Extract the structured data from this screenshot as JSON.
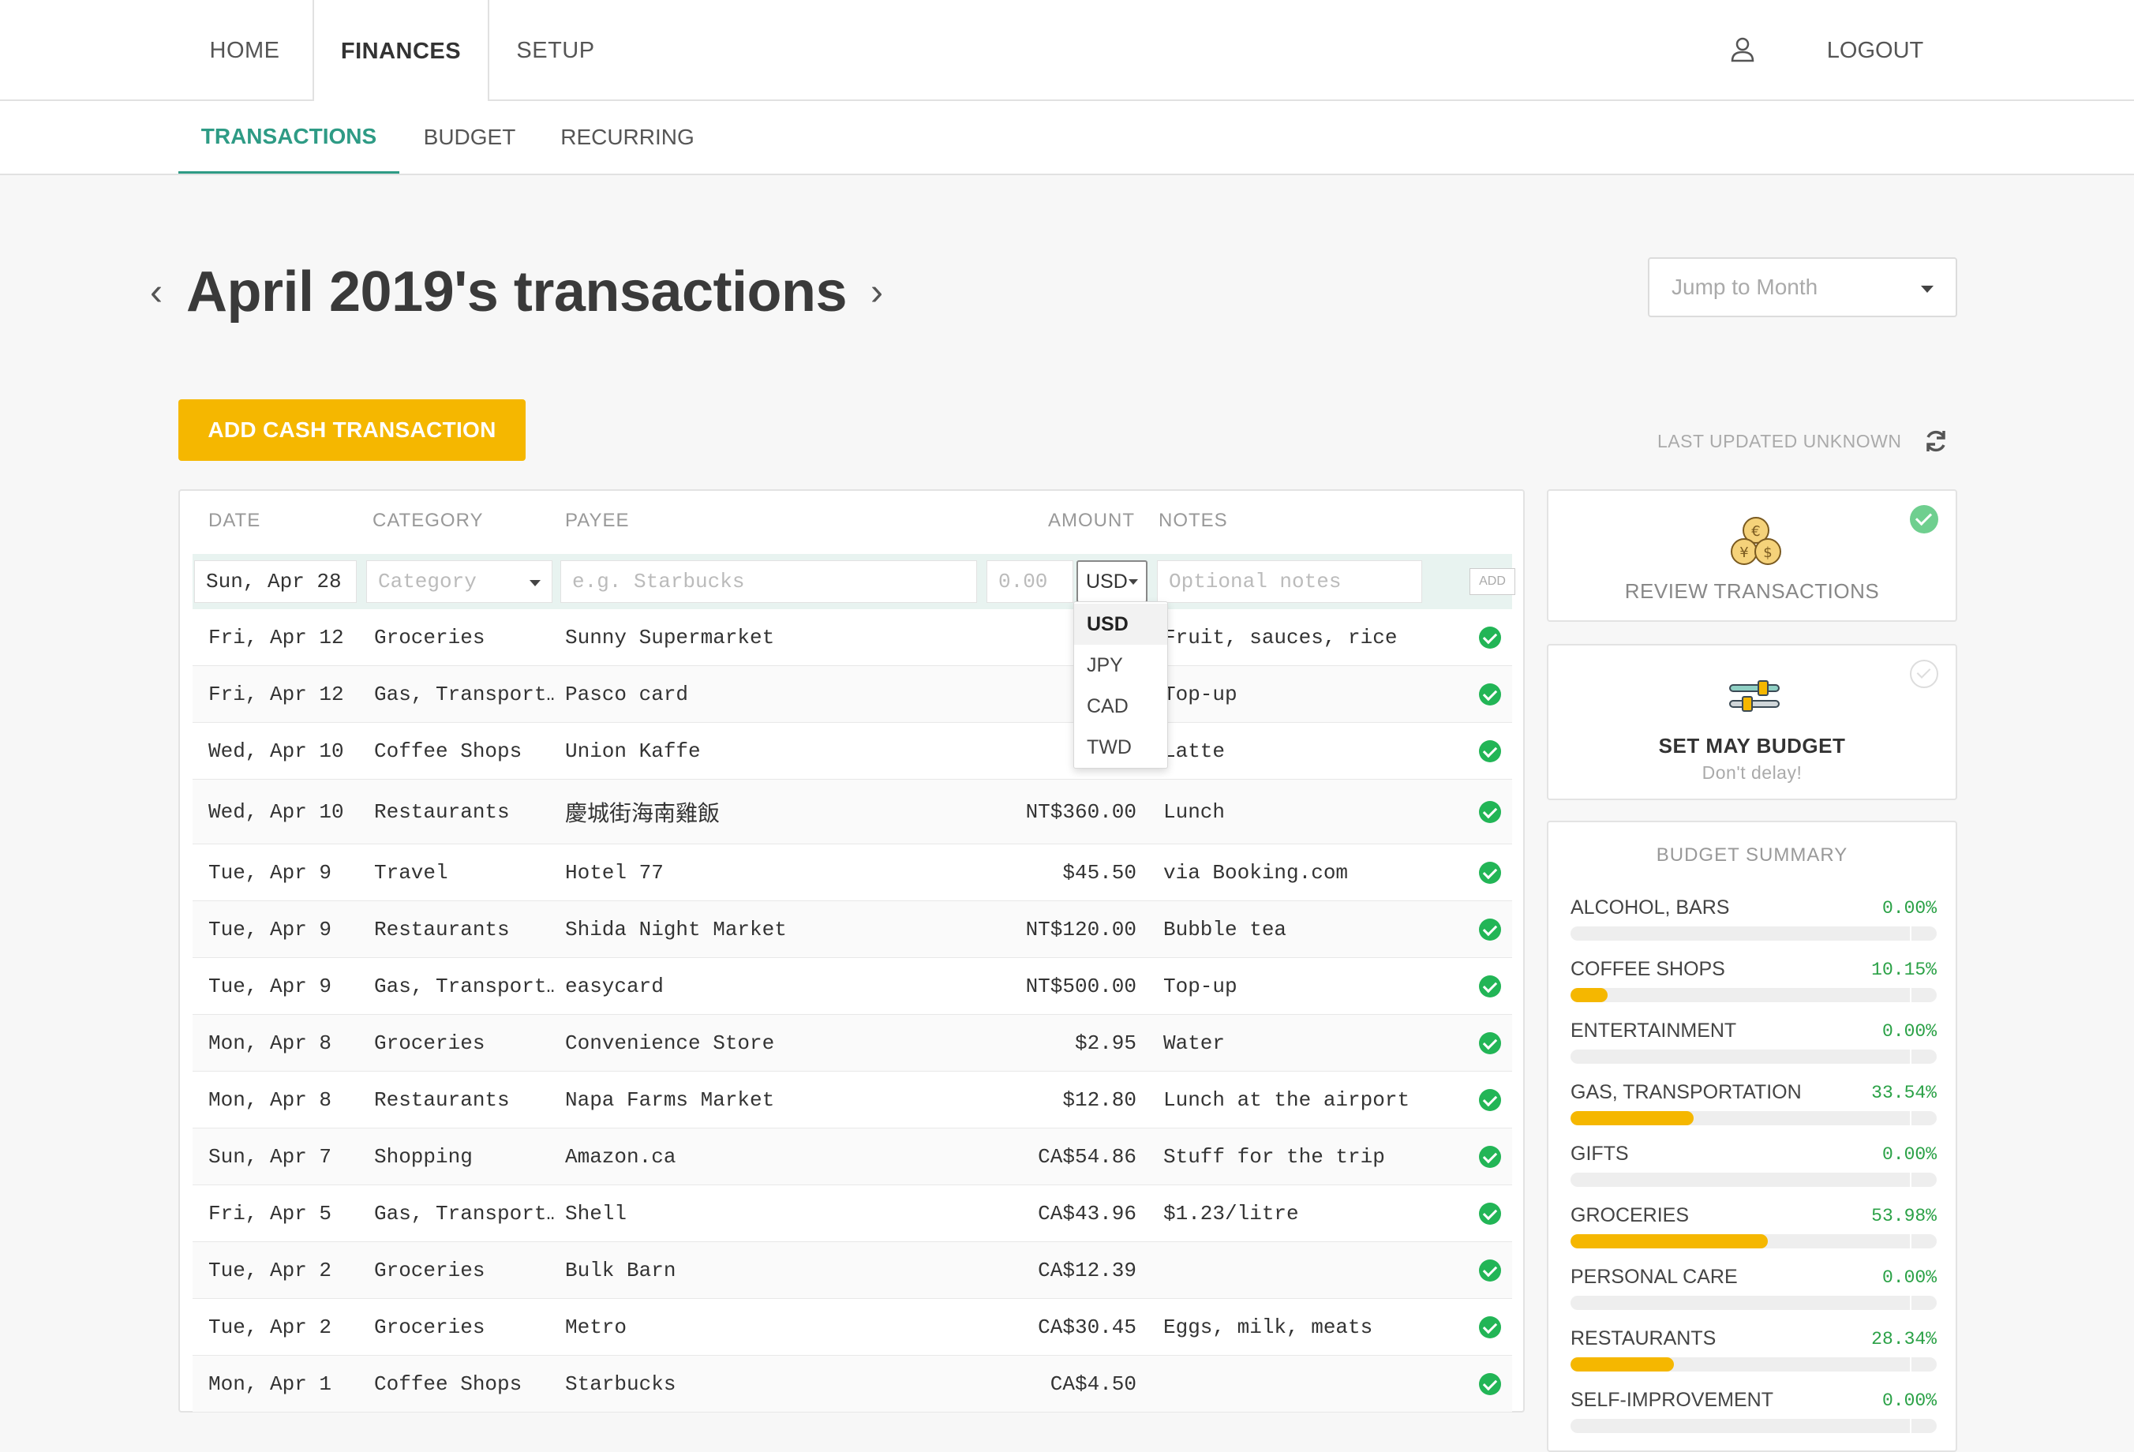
{
  "nav": {
    "tabs": [
      {
        "label": "HOME"
      },
      {
        "label": "FINANCES"
      },
      {
        "label": "SETUP"
      }
    ],
    "logout": "LOGOUT",
    "user_icon": "user-icon"
  },
  "subnav": {
    "tabs": [
      {
        "label": "TRANSACTIONS"
      },
      {
        "label": "BUDGET"
      },
      {
        "label": "RECURRING"
      }
    ]
  },
  "header": {
    "title": "April 2019's transactions",
    "jump_placeholder": "Jump to Month"
  },
  "actions": {
    "add_button": "ADD CASH TRANSACTION",
    "last_updated": "LAST UPDATED UNKNOWN"
  },
  "table": {
    "columns": [
      "DATE",
      "CATEGORY",
      "PAYEE",
      "AMOUNT",
      "NOTES"
    ],
    "entry": {
      "date": "Sun, Apr 28",
      "category_placeholder": "Category",
      "payee_placeholder": "e.g. Starbucks",
      "amount_placeholder": "0.00",
      "currency": "USD",
      "notes_placeholder": "Optional notes",
      "add_label": "ADD"
    },
    "currency_options": [
      "USD",
      "JPY",
      "CAD",
      "TWD"
    ],
    "rows": [
      {
        "date": "Fri, Apr 12",
        "category": "Groceries",
        "payee": "Sunny Supermarket",
        "amount": "",
        "notes": "Fruit, sauces, rice"
      },
      {
        "date": "Fri, Apr 12",
        "category": "Gas, Transport…",
        "payee": "Pasco card",
        "amount": "",
        "notes": "Top-up"
      },
      {
        "date": "Wed, Apr 10",
        "category": "Coffee Shops",
        "payee": "Union Kaffe",
        "amount": "NT$",
        "notes": "Latte"
      },
      {
        "date": "Wed, Apr 10",
        "category": "Restaurants",
        "payee": "慶城街海南雞飯",
        "amount": "NT$360.00",
        "notes": "Lunch"
      },
      {
        "date": "Tue, Apr 9",
        "category": "Travel",
        "payee": "Hotel 77",
        "amount": "$45.50",
        "notes": "via Booking.com"
      },
      {
        "date": "Tue, Apr 9",
        "category": "Restaurants",
        "payee": "Shida Night Market",
        "amount": "NT$120.00",
        "notes": "Bubble tea"
      },
      {
        "date": "Tue, Apr 9",
        "category": "Gas, Transport…",
        "payee": "easycard",
        "amount": "NT$500.00",
        "notes": "Top-up"
      },
      {
        "date": "Mon, Apr 8",
        "category": "Groceries",
        "payee": "Convenience Store",
        "amount": "$2.95",
        "notes": "Water"
      },
      {
        "date": "Mon, Apr 8",
        "category": "Restaurants",
        "payee": "Napa Farms Market",
        "amount": "$12.80",
        "notes": "Lunch at the airport"
      },
      {
        "date": "Sun, Apr 7",
        "category": "Shopping",
        "payee": "Amazon.ca",
        "amount": "CA$54.86",
        "notes": "Stuff for the trip"
      },
      {
        "date": "Fri, Apr 5",
        "category": "Gas, Transport…",
        "payee": "Shell",
        "amount": "CA$43.96",
        "notes": "$1.23/litre"
      },
      {
        "date": "Tue, Apr 2",
        "category": "Groceries",
        "payee": "Bulk Barn",
        "amount": "CA$12.39",
        "notes": ""
      },
      {
        "date": "Tue, Apr 2",
        "category": "Groceries",
        "payee": "Metro",
        "amount": "CA$30.45",
        "notes": "Eggs, milk, meats"
      },
      {
        "date": "Mon, Apr 1",
        "category": "Coffee Shops",
        "payee": "Starbucks",
        "amount": "CA$4.50",
        "notes": ""
      }
    ]
  },
  "panels": {
    "review": {
      "title": "REVIEW TRANSACTIONS"
    },
    "set_budget": {
      "title": "SET MAY BUDGET",
      "subtitle": "Don't delay!"
    },
    "summary": {
      "title": "BUDGET SUMMARY",
      "items": [
        {
          "name": "ALCOHOL, BARS",
          "pct": "0.00%",
          "fill": 0
        },
        {
          "name": "COFFEE SHOPS",
          "pct": "10.15%",
          "fill": 10.15
        },
        {
          "name": "ENTERTAINMENT",
          "pct": "0.00%",
          "fill": 0
        },
        {
          "name": "GAS, TRANSPORTATION",
          "pct": "33.54%",
          "fill": 33.54
        },
        {
          "name": "GIFTS",
          "pct": "0.00%",
          "fill": 0
        },
        {
          "name": "GROCERIES",
          "pct": "53.98%",
          "fill": 53.98
        },
        {
          "name": "PERSONAL CARE",
          "pct": "0.00%",
          "fill": 0
        },
        {
          "name": "RESTAURANTS",
          "pct": "28.34%",
          "fill": 28.34
        },
        {
          "name": "SELF-IMPROVEMENT",
          "pct": "0.00%",
          "fill": 0
        }
      ]
    }
  },
  "colors": {
    "accent": "#2e9b85",
    "primary_button": "#f5b700",
    "success": "#22b556"
  }
}
